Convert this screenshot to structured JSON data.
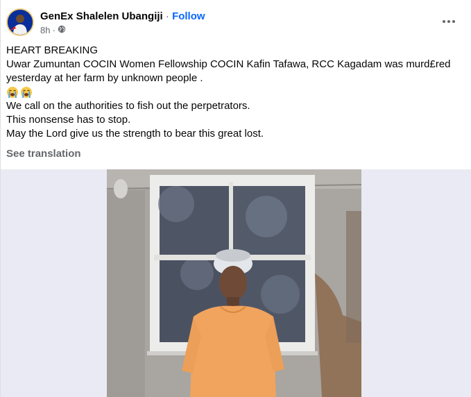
{
  "post": {
    "author": "GenEx Shalelen Ubangiji",
    "separator": "·",
    "follow_label": "Follow",
    "time": "8h",
    "time_sep": "·",
    "audience_icon": "globe-icon",
    "more_icon": "more-options-icon",
    "lines": [
      "HEART BREAKING",
      "Uwar Zumuntan COCIN Women Fellowship COCIN Kafin Tafawa, RCC Kagadam was murd£red",
      "yesterday at her farm by unknown people .",
      "We call on the authorities to fish out the perpetrators.",
      "This nonsense has to stop.",
      "May the Lord give us the strength to bear this great lost."
    ],
    "emoji_names": [
      "loudly-crying-face-icon",
      "loudly-crying-face-icon"
    ],
    "see_translation": "See translation"
  },
  "colors": {
    "link_blue": "#0866ff",
    "meta_gray": "#65676b",
    "text": "#050505",
    "media_bg": "#e9eaf3"
  }
}
